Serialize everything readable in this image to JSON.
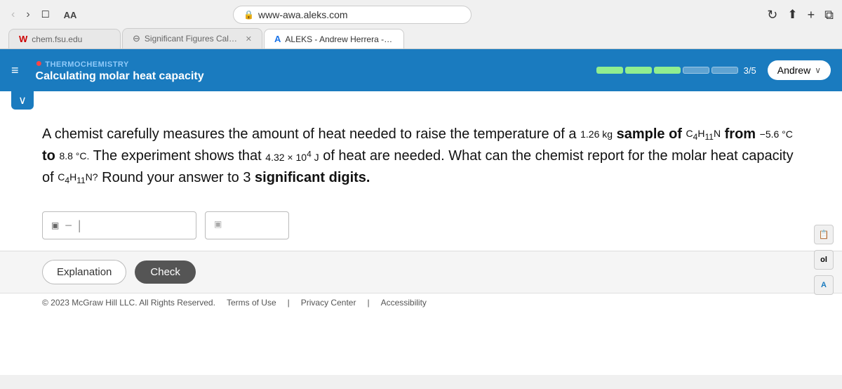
{
  "browser": {
    "address": "www-awa.aleks.com",
    "lock_icon": "🔒",
    "nav_back": "‹",
    "nav_forward": "›",
    "book_icon": "□",
    "reload_icon": "↻",
    "share_icon": "↑",
    "add_icon": "+",
    "copy_icon": "⊡"
  },
  "tabs": [
    {
      "id": "tab1",
      "favicon": "W",
      "label": "chem.fsu.edu",
      "active": false
    },
    {
      "id": "tab2",
      "favicon": "⊖",
      "label": "Significant Figures Calculator and...",
      "active": false,
      "close": "✕"
    },
    {
      "id": "tab3",
      "favicon": "A",
      "label": "ALEKS - Andrew Herrera - Learn",
      "active": true
    }
  ],
  "header": {
    "topic_category": "THERMOCHEMISTRY",
    "topic_title": "Calculating molar heat capacity",
    "progress": {
      "filled": 3,
      "empty": 2,
      "total": 5,
      "label": "3/5"
    },
    "user": {
      "name": "Andrew",
      "chevron": "∨"
    }
  },
  "question": {
    "text_parts": {
      "intro": "A chemist carefully measures the amount of heat needed to raise the temperature of a",
      "mass": "1.26 kg",
      "sample": "sample of",
      "compound": "C₄H₁₁N",
      "from": "from",
      "temp1": "−5.6 °C",
      "to": "to",
      "temp2": "8.8 °C.",
      "the": "The experiment shows that",
      "heat": "4.32 × 10⁴ J",
      "rest": "of heat are needed. What can the chemist report for the molar heat capacity of",
      "compound2": "C₄H₁₁N?",
      "round": "Round your answer to",
      "sig_figs": "3",
      "end": "significant digits."
    },
    "full_text": "A chemist carefully measures the amount of heat needed to raise the temperature of a 1.26 kg sample of C₄H₁₁N from −5.6 °C to 8.8 °C. The experiment shows that 4.32 × 10⁴ J of heat are needed. What can the chemist report for the molar heat capacity of C₄H₁₁N? Round your answer to 3 significant digits."
  },
  "answer": {
    "placeholder": "",
    "unit_placeholder": ""
  },
  "buttons": {
    "explanation": "Explanation",
    "check": "Check"
  },
  "footer": {
    "copyright": "© 2023 McGraw Hill LLC. All Rights Reserved.",
    "links": [
      "Terms of Use",
      "Privacy Center",
      "Accessibility"
    ]
  }
}
